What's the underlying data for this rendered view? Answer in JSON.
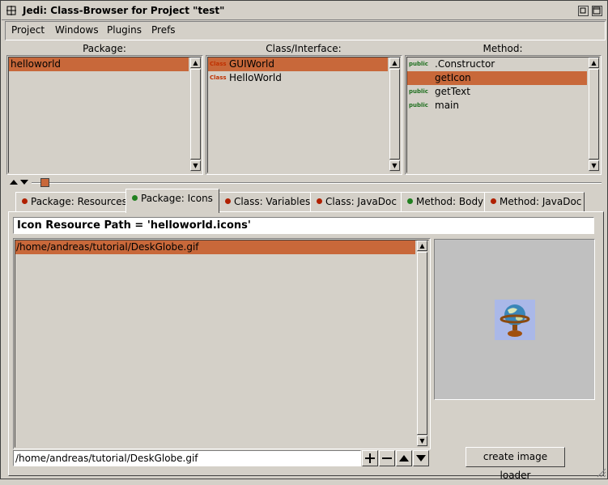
{
  "window": {
    "title": "Jedi: Class-Browser for Project \"test\""
  },
  "menu": [
    "Project",
    "Windows",
    "Plugins",
    "Prefs"
  ],
  "columns": {
    "package": "Package:",
    "class": "Class/Interface:",
    "method": "Method:"
  },
  "packages": [
    {
      "label": "helloworld",
      "selected": true
    }
  ],
  "classes": [
    {
      "tag": "Class",
      "label": "GUIWorld",
      "selected": true
    },
    {
      "tag": "Class",
      "label": "HelloWorld",
      "selected": false
    }
  ],
  "methods": [
    {
      "tag": "public",
      "label": ".Constructor",
      "selected": false
    },
    {
      "tag": "",
      "label": "getIcon",
      "selected": true
    },
    {
      "tag": "public",
      "label": "getText",
      "selected": false
    },
    {
      "tag": "public",
      "label": "main",
      "selected": false
    }
  ],
  "tabs": [
    {
      "label": "Package: Resources",
      "dot": "red",
      "active": false
    },
    {
      "label": "Package: Icons",
      "dot": "green",
      "active": true
    },
    {
      "label": "Class: Variables",
      "dot": "red",
      "active": false
    },
    {
      "label": "Class: JavaDoc",
      "dot": "red",
      "active": false
    },
    {
      "label": "Method: Body",
      "dot": "green",
      "active": false
    },
    {
      "label": "Method: JavaDoc",
      "dot": "red",
      "active": false
    }
  ],
  "icons_panel": {
    "header": "Icon Resource Path = 'helloworld.icons'",
    "files": [
      {
        "label": "/home/andreas/tutorial/DeskGlobe.gif",
        "selected": true
      }
    ],
    "path_input": "/home/andreas/tutorial/DeskGlobe.gif",
    "create_button": "create image loader",
    "preview_icon": "globe-icon"
  },
  "colors": {
    "selection": "#c8683a",
    "background": "#d4d0c8",
    "preview_bg": "#c0c0c0"
  }
}
